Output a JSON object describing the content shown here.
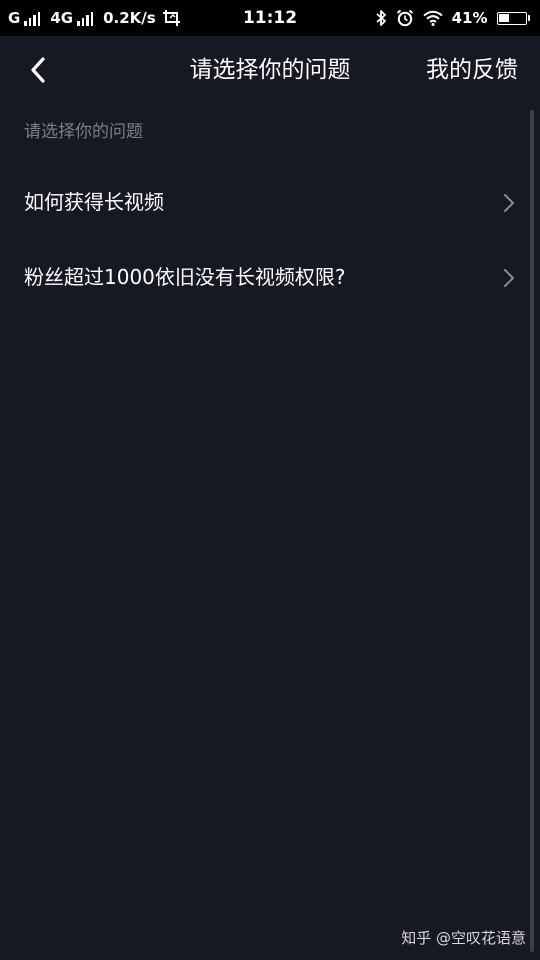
{
  "status_bar": {
    "carrier1": "G",
    "carrier2": "4G",
    "net_speed": "0.2K/s",
    "time": "11:12",
    "battery_percent": "41%",
    "battery_level": 0.41,
    "icons": [
      "signal-icon",
      "screenshot-icon",
      "bluetooth-icon",
      "alarm-icon",
      "wifi-icon",
      "battery-icon"
    ]
  },
  "nav": {
    "back_icon": "chevron-left-icon",
    "title": "请选择你的问题",
    "action_label": "我的反馈"
  },
  "section_label": "请选择你的问题",
  "list": {
    "items": [
      {
        "label": "如何获得长视频"
      },
      {
        "label": "粉丝超过1000依旧没有长视频权限?"
      }
    ],
    "chevron_icon": "chevron-right-icon"
  },
  "watermark": "知乎 @空叹花语意",
  "colors": {
    "background": "#161823",
    "status_bar": "#000000",
    "muted_text": "#7c7e88",
    "chevron": "#8a8c96"
  }
}
